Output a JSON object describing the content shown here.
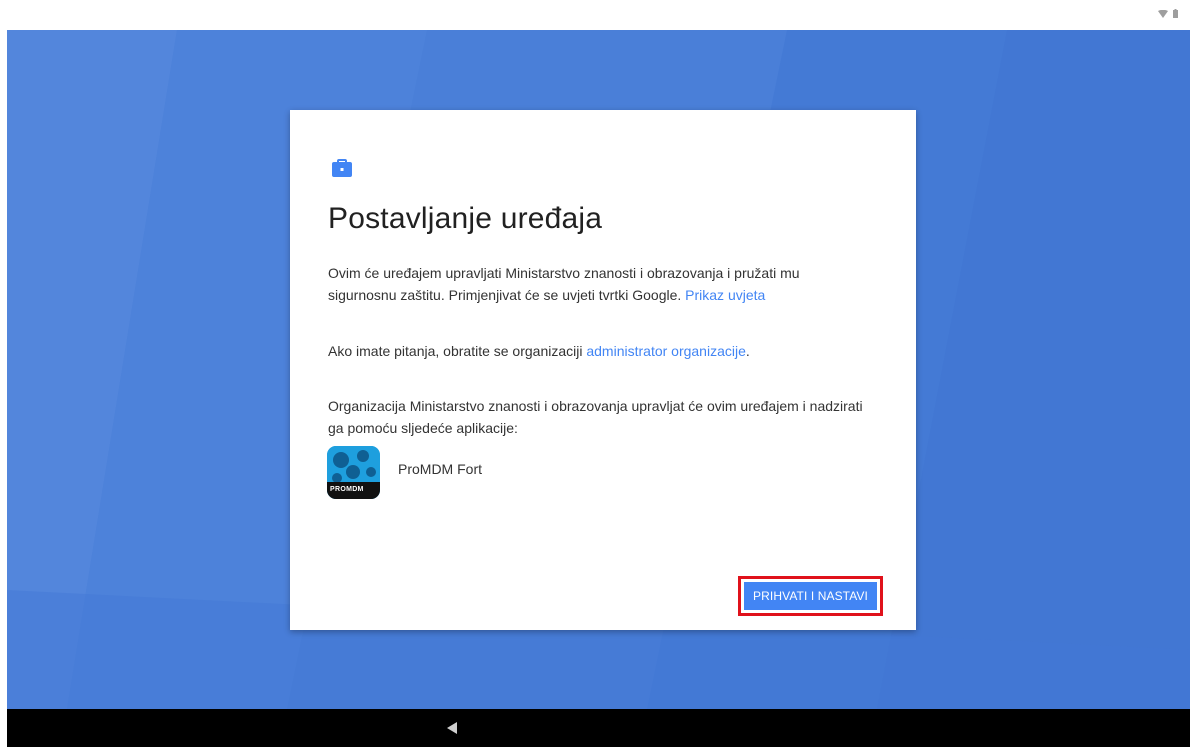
{
  "status_bar": {
    "icons": [
      "wifi-icon",
      "battery-icon"
    ]
  },
  "dialog": {
    "icon": "briefcase-icon",
    "title": "Postavljanje uređaja",
    "paragraph1_text": "Ovim će uređajem upravljati Ministarstvo znanosti i obrazovanja i pružati mu sigurnosnu zaštitu. Primjenjivat će se uvjeti tvrtki Google. ",
    "paragraph1_link": "Prikaz uvjeta",
    "paragraph2_text": "Ako imate pitanja, obratite se organizaciji ",
    "paragraph2_link": "administrator organizacije",
    "paragraph2_end": ".",
    "paragraph3_text": "Organizacija Ministarstvo znanosti i obrazovanja upravljat će ovim uređajem i nadzirati ga pomoću sljedeće aplikacije:",
    "app": {
      "name": "ProMDM Fort",
      "icon_label": "PROMDM"
    },
    "accept_button_label": "PRIHVATI I NASTAVI"
  },
  "colors": {
    "wallpaper": "#4a7fd8",
    "accent": "#4285f4",
    "highlight_frame": "#e0111b"
  },
  "nav_bar": {
    "icons": [
      "back-icon"
    ]
  }
}
